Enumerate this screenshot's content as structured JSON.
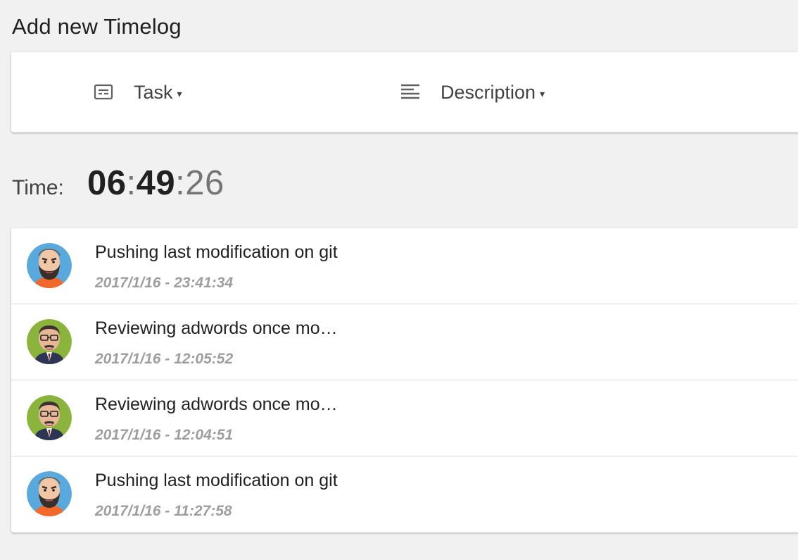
{
  "header": {
    "title": "Add new Timelog"
  },
  "selectors": {
    "task": {
      "label": "Task",
      "icon": "task-card-icon",
      "caret": "▾"
    },
    "description": {
      "label": "Description",
      "icon": "text-align-left-icon",
      "caret": "▾"
    }
  },
  "timer": {
    "label": "Time:",
    "hours": "06",
    "minutes": "49",
    "seconds": "26",
    "separator": ":"
  },
  "timelogs": [
    {
      "title": "Pushing last modification on git",
      "timestamp": "2017/1/16 - 23:41:34",
      "avatar": "bald-bearded-man-avatar",
      "avatar_bg": "#5aa9dc"
    },
    {
      "title": "Reviewing adwords once mo…",
      "timestamp": "2017/1/16 - 12:05:52",
      "avatar": "glasses-man-avatar",
      "avatar_bg": "#8bb43c"
    },
    {
      "title": "Reviewing adwords once mo…",
      "timestamp": "2017/1/16 - 12:04:51",
      "avatar": "glasses-man-avatar",
      "avatar_bg": "#8bb43c"
    },
    {
      "title": "Pushing last modification on git",
      "timestamp": "2017/1/16 - 11:27:58",
      "avatar": "bald-bearded-man-avatar",
      "avatar_bg": "#5aa9dc"
    }
  ]
}
